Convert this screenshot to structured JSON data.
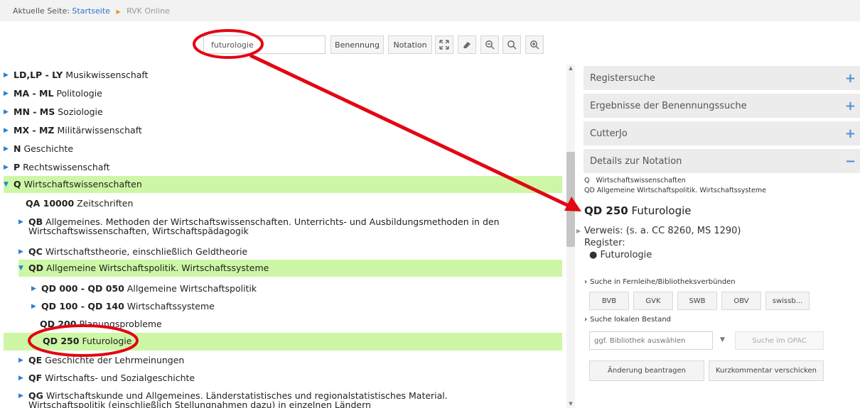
{
  "breadcrumb": {
    "prefix": "Aktuelle Seite:",
    "home": "Startseite",
    "current": "RVK Online"
  },
  "toolbar": {
    "search_value": "futurologie",
    "benennung": "Benennung",
    "notation": "Notation",
    "icons": [
      "expand-icon",
      "eraser-icon",
      "zoom-out-icon",
      "search-icon",
      "zoom-in-icon"
    ]
  },
  "tree": [
    {
      "code": "LD,LP - LY",
      "label": "Musikwissenschaft"
    },
    {
      "code": "MA - ML",
      "label": "Politologie"
    },
    {
      "code": "MN - MS",
      "label": "Soziologie"
    },
    {
      "code": "MX - MZ",
      "label": "Militärwissenschaft"
    },
    {
      "code": "N",
      "label": "Geschichte"
    },
    {
      "code": "P",
      "label": "Rechtswissenschaft"
    },
    {
      "code": "Q",
      "label": "Wirtschaftswissenschaften"
    },
    {
      "code": "QA 10000",
      "label": "Zeitschriften"
    },
    {
      "code": "QB",
      "label": "Allgemeines. Methoden der Wirtschaftswissenschaften. Unterrichts- und Ausbildungsmethoden in den",
      "label2": "Wirtschaftswissenschaften, Wirtschaftspädagogik"
    },
    {
      "code": "QC",
      "label": "Wirtschaftstheorie, einschließlich Geldtheorie"
    },
    {
      "code": "QD",
      "label": "Allgemeine Wirtschaftspolitik. Wirtschaftssysteme"
    },
    {
      "code": "QD 000 - QD 050",
      "label": "Allgemeine Wirtschaftspolitik"
    },
    {
      "code": "QD 100 - QD 140",
      "label": "Wirtschaftssysteme"
    },
    {
      "code": "QD 200",
      "label": "Planungsprobleme"
    },
    {
      "code": "QD 250",
      "label": "Futurologie"
    },
    {
      "code": "QE",
      "label": "Geschichte der Lehrmeinungen"
    },
    {
      "code": "QF",
      "label": "Wirtschafts- und Sozialgeschichte"
    },
    {
      "code": "QG",
      "label": "Wirtschaftskunde und Allgemeines. Länderstatistisches und regionalstatistisches Material.",
      "label2": "Wirtschaftspolitik (einschließlich Stellungnahmen dazu) in einzelnen Ländern"
    }
  ],
  "panel": {
    "sections": [
      {
        "title": "Registersuche",
        "sign": "+"
      },
      {
        "title": "Ergebnisse der Benennungssuche",
        "sign": "+"
      },
      {
        "title": "CutterJo",
        "sign": "+"
      },
      {
        "title": "Details zur Notation",
        "sign": "−"
      }
    ],
    "details": {
      "path1": "Q   Wirtschaftswissenschaften",
      "path2": "QD Allgemeine Wirtschaftspolitik. Wirtschaftssysteme",
      "code": "QD 250",
      "name": "Futurologie",
      "verweis_label": "Verweis:",
      "verweis_value": "(s. a. CC 8260, MS 1290)",
      "register_label": "Register:",
      "register_item": "Futurologie"
    },
    "fernleihe_title": "Suche in Fernleihe/Bibliotheksverbünden",
    "libraries": [
      "BVB",
      "GVK",
      "SWB",
      "OBV",
      "swissb..."
    ],
    "lokal_title": "Suche lokalen Bestand",
    "lib_placeholder": "ggf. Bibliothek auswählen",
    "opac_btn": "Suche im OPAC",
    "change_btn": "Änderung beantragen",
    "comment_btn": "Kurzkommentar verschicken"
  },
  "colors": {
    "highlight": "#cdf7a6",
    "link": "#2f73c9",
    "accent_plus": "#4a90d9",
    "annotation": "#e30613"
  }
}
